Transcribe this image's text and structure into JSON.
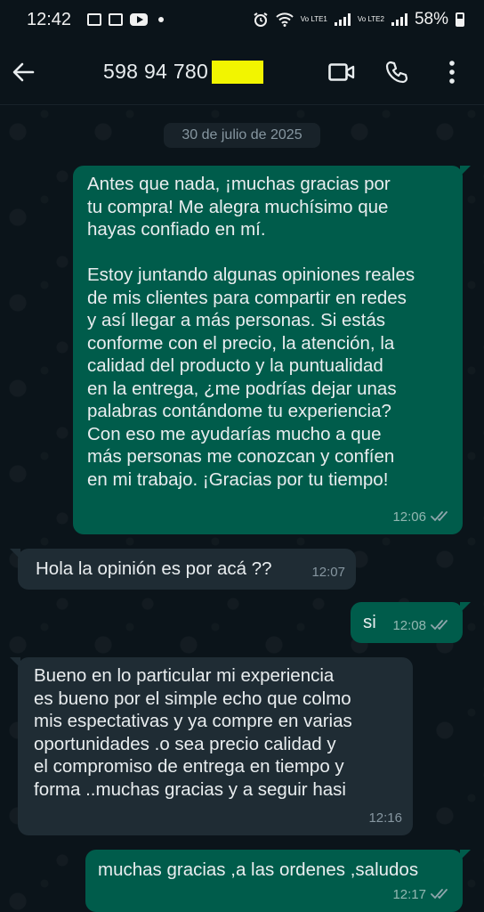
{
  "status_bar": {
    "time": "12:42",
    "battery": "58%",
    "lte1": "Vo LTE1",
    "lte2": "Vo LTE2"
  },
  "header": {
    "contact_number": "598 94 780",
    "icons": [
      "back-arrow-icon",
      "video-call-icon",
      "phone-icon",
      "more-vert-icon"
    ]
  },
  "chat": {
    "date_label": "30 de julio de 2025",
    "messages": [
      {
        "direction": "outgoing",
        "text": "Antes que nada, ¡muchas gracias por\ntu compra! Me alegra muchísimo que\nhayas confiado en mí.\n\nEstoy juntando algunas opiniones reales\nde mis clientes para compartir en redes\ny así llegar a más personas. Si estás\nconforme con el precio, la atención, la\ncalidad del producto y la puntualidad\nen la entrega, ¿me podrías dejar unas\npalabras contándome tu experiencia?\nCon eso me ayudarías  mucho a que\nmás personas me conozcan y confíen\nen mi trabajo. ¡Gracias por tu tiempo!",
        "time": "12:06",
        "status": "read"
      },
      {
        "direction": "incoming",
        "text": "Hola la opinión es por acá ??",
        "time": "12:07"
      },
      {
        "direction": "outgoing",
        "text": "si",
        "time": "12:08",
        "status": "read"
      },
      {
        "direction": "incoming",
        "text": "Bueno en lo particular mi experiencia\nes bueno por el simple echo que colmo\nmis espectativas y ya compre  en varias\noportunidades .o sea precio calidad y\nel compromiso de entrega en tiempo y\nforma ..muchas gracias y a seguir hasi",
        "time": "12:16"
      },
      {
        "direction": "outgoing",
        "text": "muchas gracias ,a las ordenes ,saludos",
        "time": "12:17",
        "status": "read"
      }
    ]
  },
  "colors": {
    "background": "#0b141a",
    "outgoing_bubble": "#005c4b",
    "incoming_bubble": "#1f2c34",
    "read_tick": "#8696a0",
    "redaction": "#f2f500"
  }
}
